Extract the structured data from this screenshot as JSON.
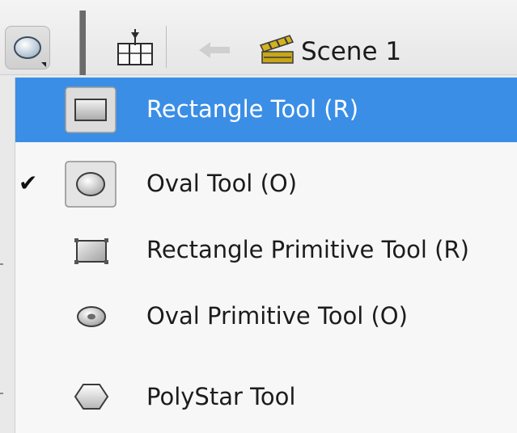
{
  "toolbar": {
    "current_tool_icon": "oval-tool-icon",
    "timeline_icon": "timeline-icon",
    "back_icon": "back-arrow-icon",
    "scene_icon": "clapperboard-icon",
    "scene_label": "Scene 1"
  },
  "menu": {
    "items": [
      {
        "label": "Rectangle Tool (R)",
        "icon": "rectangle-tool-icon",
        "selected": true,
        "checked": false
      },
      {
        "label": "Oval Tool (O)",
        "icon": "oval-tool-icon",
        "selected": false,
        "checked": true
      },
      {
        "label": "Rectangle Primitive Tool (R)",
        "icon": "rectangle-primitive-tool-icon",
        "selected": false,
        "checked": false
      },
      {
        "label": "Oval Primitive Tool (O)",
        "icon": "oval-primitive-tool-icon",
        "selected": false,
        "checked": false
      },
      {
        "label": "PolyStar Tool",
        "icon": "polystar-tool-icon",
        "selected": false,
        "checked": false
      }
    ],
    "check_glyph": "✔"
  },
  "colors": {
    "highlight": "#3a8ee6",
    "menu_bg": "#f7f7f7",
    "toolbar_bg": "#ececec"
  }
}
